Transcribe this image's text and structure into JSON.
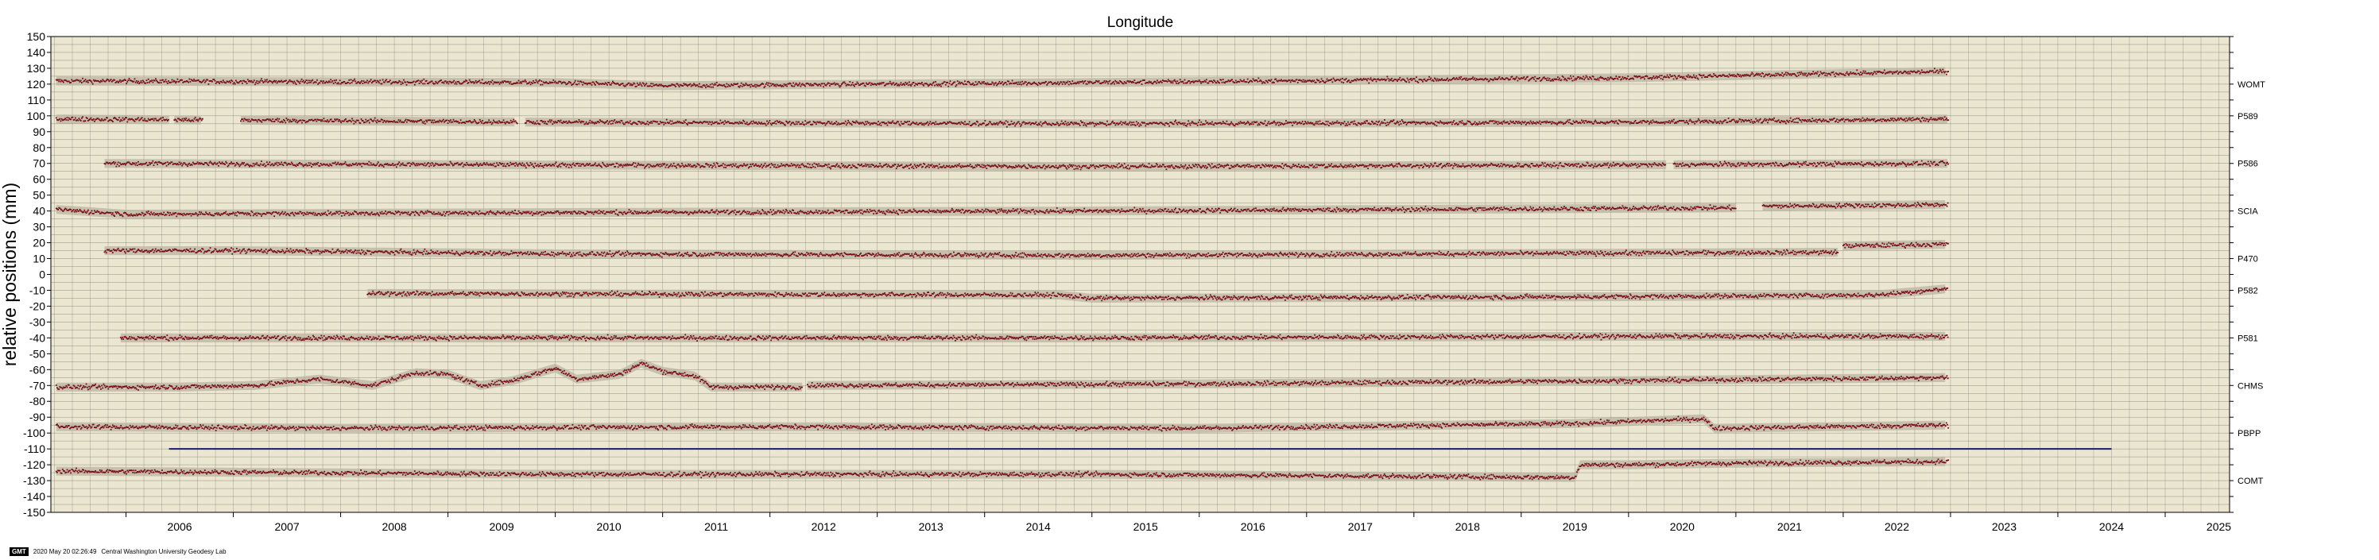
{
  "chart_data": {
    "type": "scatter",
    "title": "Longitude",
    "ylabel": "relative positions (mm)",
    "xlabel": "",
    "xlim": [
      2005.3,
      2025.6
    ],
    "ylim": [
      -150,
      150
    ],
    "ytick_step": 10,
    "xtick_labels": [
      "2006",
      "2007",
      "2008",
      "2009",
      "2010",
      "2011",
      "2012",
      "2013",
      "2014",
      "2015",
      "2016",
      "2017",
      "2018",
      "2019",
      "2020",
      "2021",
      "2022",
      "2023",
      "2024",
      "2025"
    ],
    "grid": true,
    "background": "#ebe6d0",
    "point_color": "#7a0d14",
    "band_color": "#b9b3a2",
    "reference_line": {
      "start": 2006.4,
      "end": 2024.5,
      "y": -110,
      "color": "#1a1a7a"
    },
    "series": [
      {
        "name": "WOMT",
        "offset": 120,
        "start": 2005.35,
        "end": 2022.98,
        "segments": [
          [
            2005.35,
            2022.98
          ]
        ],
        "trend": [
          [
            2005.35,
            122
          ],
          [
            2010,
            121
          ],
          [
            2011,
            119
          ],
          [
            2015,
            121
          ],
          [
            2020,
            124
          ],
          [
            2022.98,
            128
          ]
        ]
      },
      {
        "name": "P589",
        "offset": 100,
        "start": 2005.35,
        "end": 2022.98,
        "segments": [
          [
            2005.35,
            2006.4
          ],
          [
            2006.45,
            2006.72
          ],
          [
            2007.07,
            2009.65
          ],
          [
            2009.72,
            2022.98
          ]
        ],
        "trend": [
          [
            2005.35,
            98
          ],
          [
            2010,
            96
          ],
          [
            2015,
            95
          ],
          [
            2020,
            96
          ],
          [
            2022.98,
            98
          ]
        ]
      },
      {
        "name": "P586",
        "offset": 70,
        "start": 2005.8,
        "end": 2022.98,
        "segments": [
          [
            2005.8,
            2020.35
          ],
          [
            2020.42,
            2022.98
          ]
        ],
        "trend": [
          [
            2005.8,
            70
          ],
          [
            2010,
            69
          ],
          [
            2015,
            68
          ],
          [
            2020,
            69
          ],
          [
            2022.98,
            70
          ]
        ]
      },
      {
        "name": "SCIA",
        "offset": 40,
        "start": 2005.35,
        "end": 2022.98,
        "segments": [
          [
            2005.35,
            2021.0
          ],
          [
            2021.25,
            2022.98
          ]
        ],
        "trend": [
          [
            2005.35,
            41
          ],
          [
            2006,
            38
          ],
          [
            2010,
            39
          ],
          [
            2015,
            40
          ],
          [
            2021,
            42
          ],
          [
            2021.25,
            43
          ],
          [
            2022.98,
            44
          ]
        ]
      },
      {
        "name": "P470",
        "offset": 10,
        "start": 2005.8,
        "end": 2022.98,
        "segments": [
          [
            2005.8,
            2021.95
          ],
          [
            2022.0,
            2022.98
          ]
        ],
        "trend": [
          [
            2005.8,
            15
          ],
          [
            2007,
            15
          ],
          [
            2010,
            13
          ],
          [
            2015,
            12
          ],
          [
            2021.95,
            14
          ],
          [
            2022.0,
            18
          ],
          [
            2022.98,
            19
          ]
        ]
      },
      {
        "name": "P582",
        "offset": -10,
        "start": 2008.25,
        "end": 2022.98,
        "segments": [
          [
            2008.25,
            2022.98
          ]
        ],
        "trend": [
          [
            2008.25,
            -12
          ],
          [
            2014.7,
            -13
          ],
          [
            2015.0,
            -15
          ],
          [
            2020,
            -14
          ],
          [
            2022.3,
            -13
          ],
          [
            2022.98,
            -9
          ]
        ]
      },
      {
        "name": "P581",
        "offset": -40,
        "start": 2005.95,
        "end": 2022.98,
        "segments": [
          [
            2005.95,
            2022.98
          ]
        ],
        "trend": [
          [
            2005.95,
            -40
          ],
          [
            2010,
            -40
          ],
          [
            2015,
            -40
          ],
          [
            2020,
            -39
          ],
          [
            2022.98,
            -39
          ]
        ]
      },
      {
        "name": "CHMS",
        "offset": -70,
        "start": 2005.35,
        "end": 2022.98,
        "segments": [
          [
            2005.35,
            2011.45
          ],
          [
            2011.45,
            2012.3
          ],
          [
            2012.35,
            2022.98
          ]
        ],
        "trend": [
          [
            2005.35,
            -71
          ],
          [
            2006.5,
            -71
          ],
          [
            2007.2,
            -70
          ],
          [
            2007.8,
            -66
          ],
          [
            2008.3,
            -70
          ],
          [
            2008.7,
            -62
          ],
          [
            2009.0,
            -63
          ],
          [
            2009.3,
            -70
          ],
          [
            2009.6,
            -67
          ],
          [
            2010.0,
            -59
          ],
          [
            2010.2,
            -66
          ],
          [
            2010.6,
            -63
          ],
          [
            2010.8,
            -56
          ],
          [
            2011.0,
            -61
          ],
          [
            2011.3,
            -64
          ],
          [
            2011.45,
            -71
          ],
          [
            2012.3,
            -71
          ],
          [
            2012.35,
            -70
          ],
          [
            2016,
            -69
          ],
          [
            2020,
            -67
          ],
          [
            2022.98,
            -65
          ]
        ]
      },
      {
        "name": "PBPP",
        "offset": -100,
        "start": 2005.35,
        "end": 2022.98,
        "segments": [
          [
            2005.35,
            2022.98
          ]
        ],
        "trend": [
          [
            2005.35,
            -96
          ],
          [
            2008,
            -97
          ],
          [
            2012,
            -96
          ],
          [
            2016,
            -97
          ],
          [
            2019.5,
            -94
          ],
          [
            2020.7,
            -91
          ],
          [
            2020.8,
            -97
          ],
          [
            2022.98,
            -95
          ]
        ]
      },
      {
        "name": "COMT",
        "offset": -130,
        "start": 2005.35,
        "end": 2022.98,
        "segments": [
          [
            2005.35,
            2022.98
          ]
        ],
        "trend": [
          [
            2005.35,
            -124
          ],
          [
            2010,
            -126
          ],
          [
            2015,
            -126
          ],
          [
            2019.5,
            -128
          ],
          [
            2019.55,
            -120
          ],
          [
            2020,
            -120
          ],
          [
            2021,
            -119
          ],
          [
            2022.98,
            -118
          ]
        ]
      }
    ]
  },
  "footer": {
    "badge": "GMT",
    "timestamp": "2020 May 20 02:26:49",
    "credit": "Central Washington University Geodesy Lab"
  }
}
